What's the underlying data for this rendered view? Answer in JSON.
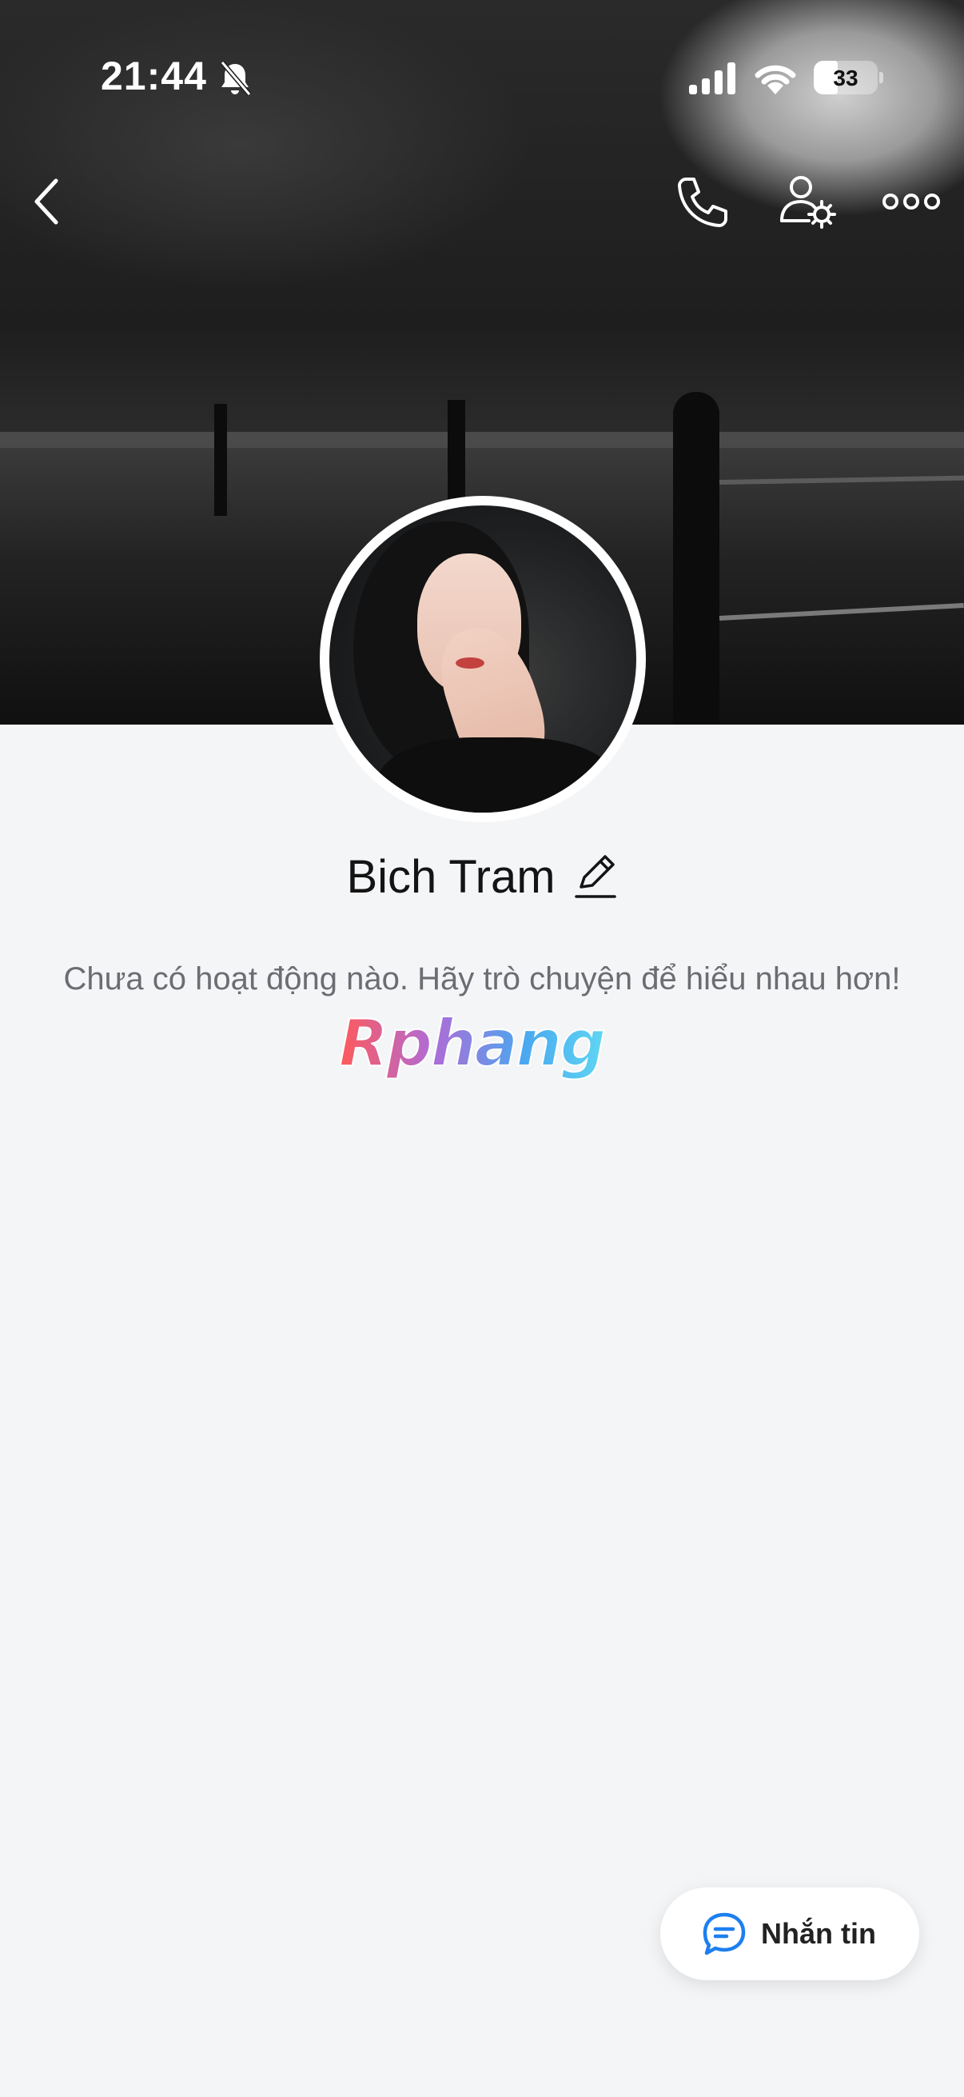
{
  "status_bar": {
    "time": "21:44",
    "battery_percent": "33",
    "icons": [
      "bell-slash-icon",
      "cellular-signal-icon",
      "wifi-icon",
      "battery-icon"
    ]
  },
  "header": {
    "icons": [
      "back-chevron-icon",
      "phone-icon",
      "user-settings-icon",
      "more-icon"
    ]
  },
  "profile": {
    "name": "Bich Tram",
    "empty_message": "Chưa có hoạt động nào. Hãy trò chuyện để hiểu nhau hơn!",
    "watermark": "Rphang"
  },
  "actions": {
    "message_button_label": "Nhắn tin"
  },
  "colors": {
    "accent": "#1d7ff0",
    "background": "#f4f5f7",
    "text_primary": "#141414",
    "text_secondary": "#6b6d72"
  }
}
